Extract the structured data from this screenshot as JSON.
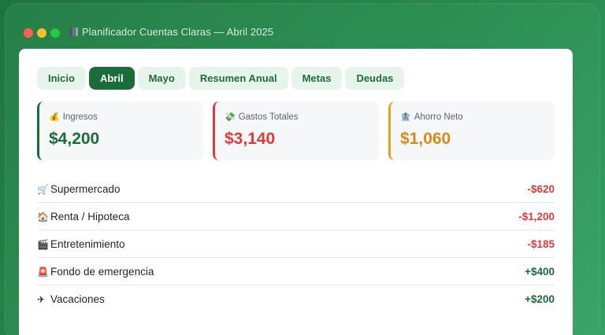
{
  "window": {
    "title": "Planificador Cuentas Claras — Abril 2025",
    "title_icon": "bar-chart-icon"
  },
  "tabs": [
    {
      "label": "Inicio",
      "active": false
    },
    {
      "label": "Abril",
      "active": true
    },
    {
      "label": "Mayo",
      "active": false
    },
    {
      "label": "Resumen Anual",
      "active": false
    },
    {
      "label": "Metas",
      "active": false
    },
    {
      "label": "Deudas",
      "active": false
    }
  ],
  "summary": {
    "income": {
      "icon": "💰",
      "icon_name": "money-bag-icon",
      "label": "Ingresos",
      "value": "$4,200",
      "color": "#1b6b3b"
    },
    "expenses": {
      "icon": "💸",
      "icon_name": "money-wings-icon",
      "label": "Gastos Totales",
      "value": "$3,140",
      "color": "#dc3b3b"
    },
    "savings": {
      "icon": "🏦",
      "icon_name": "bank-icon",
      "label": "Ahorro Neto",
      "value": "$1,060",
      "color": "#d78c17"
    }
  },
  "transactions": [
    {
      "icon": "🛒",
      "icon_name": "shopping-cart-icon",
      "label": "Supermercado",
      "amount": "-$620",
      "type": "negative"
    },
    {
      "icon": "🏠",
      "icon_name": "house-icon",
      "label": "Renta / Hipoteca",
      "amount": "-$1,200",
      "type": "negative"
    },
    {
      "icon": "🎬",
      "icon_name": "clapper-board-icon",
      "label": "Entretenimiento",
      "amount": "-$185",
      "type": "negative"
    },
    {
      "icon": "🚨",
      "icon_name": "emergency-light-icon",
      "label": "Fondo de emergencia",
      "amount": "+$400",
      "type": "positive"
    },
    {
      "icon": "✈",
      "icon_name": "airplane-icon",
      "label": "Vacaciones",
      "amount": "+$200",
      "type": "positive"
    }
  ],
  "colors": {
    "accent": "#1b6b3b",
    "negative": "#dc3b3b",
    "positive": "#1b6b3b",
    "savings": "#d78c17",
    "tab_bg": "#e6f4ec",
    "background": "#2a8a50"
  }
}
